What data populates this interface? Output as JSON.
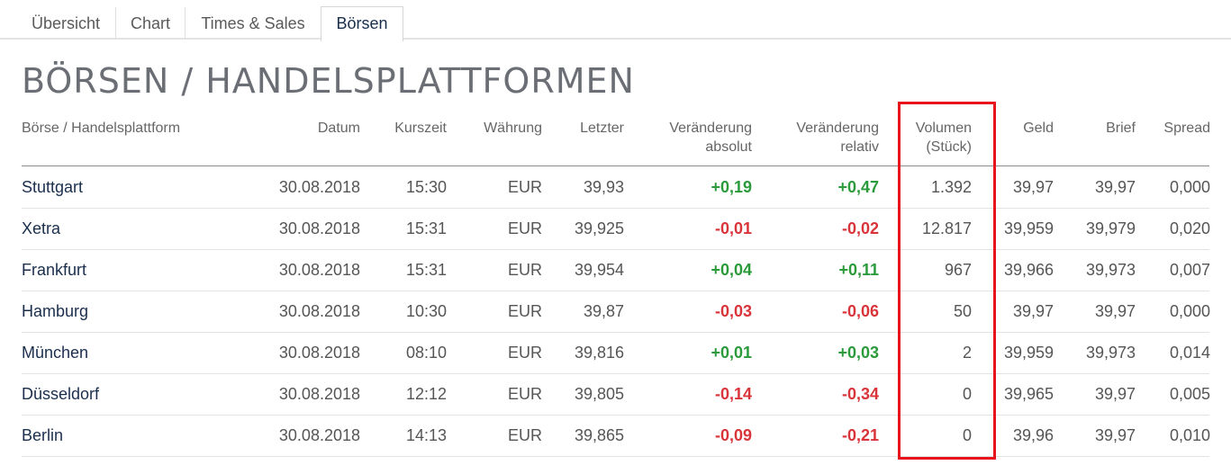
{
  "tabs": [
    {
      "label": "Übersicht",
      "active": false
    },
    {
      "label": "Chart",
      "active": false
    },
    {
      "label": "Times & Sales",
      "active": false
    },
    {
      "label": "Börsen",
      "active": true
    }
  ],
  "title": "BÖRSEN / HANDELSPLATTFORMEN",
  "columns": [
    {
      "key": "exchange",
      "label": [
        "Börse / Handelsplattform"
      ]
    },
    {
      "key": "date",
      "label": [
        "Datum"
      ]
    },
    {
      "key": "time",
      "label": [
        "Kurszeit"
      ]
    },
    {
      "key": "currency",
      "label": [
        "Währung"
      ]
    },
    {
      "key": "last",
      "label": [
        "Letzter"
      ]
    },
    {
      "key": "change_abs",
      "label": [
        "Veränderung",
        "absolut"
      ]
    },
    {
      "key": "change_rel",
      "label": [
        "Veränderung",
        "relativ"
      ]
    },
    {
      "key": "volume",
      "label": [
        "Volumen",
        "(Stück)"
      ]
    },
    {
      "key": "bid",
      "label": [
        "Geld"
      ]
    },
    {
      "key": "ask",
      "label": [
        "Brief"
      ]
    },
    {
      "key": "spread",
      "label": [
        "Spread"
      ]
    }
  ],
  "rows": [
    {
      "exchange": "Stuttgart",
      "date": "30.08.2018",
      "time": "15:30",
      "currency": "EUR",
      "last": "39,93",
      "change_abs": "+0,19",
      "change_rel": "+0,47",
      "volume": "1.392",
      "bid": "39,97",
      "ask": "39,97",
      "spread": "0,000"
    },
    {
      "exchange": "Xetra",
      "date": "30.08.2018",
      "time": "15:31",
      "currency": "EUR",
      "last": "39,925",
      "change_abs": "-0,01",
      "change_rel": "-0,02",
      "volume": "12.817",
      "bid": "39,959",
      "ask": "39,979",
      "spread": "0,020"
    },
    {
      "exchange": "Frankfurt",
      "date": "30.08.2018",
      "time": "15:31",
      "currency": "EUR",
      "last": "39,954",
      "change_abs": "+0,04",
      "change_rel": "+0,11",
      "volume": "967",
      "bid": "39,966",
      "ask": "39,973",
      "spread": "0,007"
    },
    {
      "exchange": "Hamburg",
      "date": "30.08.2018",
      "time": "10:30",
      "currency": "EUR",
      "last": "39,87",
      "change_abs": "-0,03",
      "change_rel": "-0,06",
      "volume": "50",
      "bid": "39,97",
      "ask": "39,97",
      "spread": "0,000"
    },
    {
      "exchange": "München",
      "date": "30.08.2018",
      "time": "08:10",
      "currency": "EUR",
      "last": "39,816",
      "change_abs": "+0,01",
      "change_rel": "+0,03",
      "volume": "2",
      "bid": "39,959",
      "ask": "39,973",
      "spread": "0,014"
    },
    {
      "exchange": "Düsseldorf",
      "date": "30.08.2018",
      "time": "12:12",
      "currency": "EUR",
      "last": "39,805",
      "change_abs": "-0,14",
      "change_rel": "-0,34",
      "volume": "0",
      "bid": "39,965",
      "ask": "39,97",
      "spread": "0,005"
    },
    {
      "exchange": "Berlin",
      "date": "30.08.2018",
      "time": "14:13",
      "currency": "EUR",
      "last": "39,865",
      "change_abs": "-0,09",
      "change_rel": "-0,21",
      "volume": "0",
      "bid": "39,96",
      "ask": "39,97",
      "spread": "0,010"
    }
  ],
  "colors": {
    "positive": "#2a9a3a",
    "negative": "#d9343a",
    "highlight": "#e8141b",
    "link": "#1a2e4c"
  }
}
